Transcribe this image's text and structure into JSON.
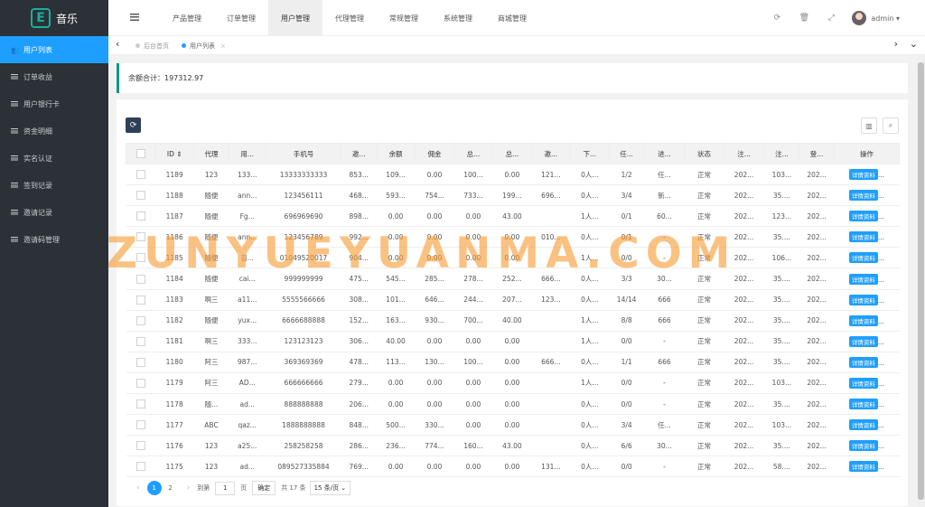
{
  "app": {
    "logo_letter": "E",
    "name": "音乐"
  },
  "sidebar": {
    "items": [
      {
        "label": "用户列表",
        "active": true
      },
      {
        "label": "订单收益"
      },
      {
        "label": "用户银行卡"
      },
      {
        "label": "资金明细"
      },
      {
        "label": "实名认证"
      },
      {
        "label": "签到记录"
      },
      {
        "label": "邀请记录"
      },
      {
        "label": "邀请码管理"
      }
    ]
  },
  "header": {
    "nav": [
      "产品管理",
      "订单管理",
      "用户管理",
      "代理管理",
      "常规管理",
      "系统管理",
      "商城管理"
    ],
    "active_nav": "用户管理",
    "user": "admin"
  },
  "tabs": [
    {
      "label": "后台首页",
      "active": false
    },
    {
      "label": "用户列表",
      "active": true,
      "close": "×"
    }
  ],
  "summary": {
    "label": "余额合计：",
    "value": "197312.97"
  },
  "table": {
    "columns": [
      "ID",
      "代理",
      "用...",
      "手机号",
      "邀...",
      "余额",
      "佣金",
      "总...",
      "总...",
      "邀...",
      "下...",
      "任...",
      "进...",
      "状态",
      "注...",
      "注...",
      "登...",
      "操作"
    ],
    "action_label": "详情资料",
    "rows": [
      [
        "1189",
        "123",
        "133...",
        "13333333333",
        "853...",
        "109...",
        "0.00",
        "100...",
        "0.00",
        "121...",
        "0人...",
        "1/2",
        "任...",
        "正常",
        "202...",
        "103...",
        "202..."
      ],
      [
        "1188",
        "随便",
        "ann...",
        "123456111",
        "468...",
        "593...",
        "754...",
        "733...",
        "199...",
        "696...",
        "0人...",
        "3/4",
        "新...",
        "正常",
        "202...",
        "35....",
        "202..."
      ],
      [
        "1187",
        "随便",
        "Fg...",
        "696969690",
        "898...",
        "0.00",
        "0.00",
        "0.00",
        "43.00",
        "",
        "1人...",
        "0/1",
        "60...",
        "正常",
        "202...",
        "123...",
        "202..."
      ],
      [
        "1186",
        "随便",
        "ann...",
        "123456789",
        "992...",
        "0.00",
        "0.00",
        "0.00",
        "0.00",
        "010...",
        "0人...",
        "0/1",
        "-",
        "正常",
        "202...",
        "35....",
        "202..."
      ],
      [
        "1185",
        "随便",
        "김...",
        "01049520017",
        "904...",
        "0.00",
        "0.00",
        "0.00",
        "0.00",
        "",
        "1人...",
        "0/0",
        "-",
        "正常",
        "202...",
        "106...",
        "202..."
      ],
      [
        "1184",
        "随便",
        "cai...",
        "999999999",
        "475...",
        "545...",
        "285...",
        "278...",
        "252...",
        "666...",
        "0人...",
        "3/3",
        "30...",
        "正常",
        "202...",
        "35....",
        "202..."
      ],
      [
        "1183",
        "啊三",
        "a11...",
        "5555566666",
        "308...",
        "101...",
        "646...",
        "244...",
        "207...",
        "123...",
        "0人...",
        "14/14",
        "666",
        "正常",
        "202...",
        "35....",
        "202..."
      ],
      [
        "1182",
        "随便",
        "yux...",
        "6666688888",
        "152...",
        "163...",
        "930...",
        "700...",
        "40.00",
        "",
        "1人...",
        "8/8",
        "666",
        "正常",
        "202...",
        "35....",
        "202..."
      ],
      [
        "1181",
        "啊三",
        "333...",
        "123123123",
        "306...",
        "40.00",
        "0.00",
        "0.00",
        "0.00",
        "",
        "1人...",
        "0/0",
        "-",
        "正常",
        "202...",
        "35....",
        "202..."
      ],
      [
        "1180",
        "阿三",
        "987...",
        "369369369",
        "478...",
        "113...",
        "130...",
        "100...",
        "0.00",
        "666...",
        "0人...",
        "1/1",
        "666",
        "正常",
        "202...",
        "35....",
        "202..."
      ],
      [
        "1179",
        "阿三",
        "AD...",
        "666666666",
        "279...",
        "0.00",
        "0.00",
        "0.00",
        "0.00",
        "",
        "1人...",
        "0/0",
        "-",
        "正常",
        "202...",
        "103...",
        "202..."
      ],
      [
        "1178",
        "随...",
        "ad...",
        "888888888",
        "206...",
        "0.00",
        "0.00",
        "0.00",
        "0.00",
        "",
        "0人...",
        "0/0",
        "-",
        "正常",
        "202...",
        "35....",
        "202..."
      ],
      [
        "1177",
        "ABC",
        "qaz...",
        "1888888888",
        "848...",
        "500...",
        "330...",
        "0.00",
        "0.00",
        "",
        "0人...",
        "3/4",
        "任...",
        "正常",
        "202...",
        "103...",
        "202..."
      ],
      [
        "1176",
        "123",
        "a25...",
        "258258258",
        "286...",
        "236...",
        "774...",
        "160...",
        "43.00",
        "",
        "0人...",
        "6/6",
        "30...",
        "正常",
        "202...",
        "35....",
        "202..."
      ],
      [
        "1175",
        "123",
        "ad...",
        "089527335884",
        "769...",
        "0.00",
        "0.00",
        "0.00",
        "0.00",
        "131...",
        "0人...",
        "0/0",
        "-",
        "正常",
        "202...",
        "58....",
        "202..."
      ]
    ]
  },
  "pager": {
    "pages": [
      "1",
      "2"
    ],
    "current": "1",
    "goto_label": "到第",
    "goto_value": "1",
    "page_unit": "页",
    "confirm": "确定",
    "total": "共 17 条",
    "per_page": "15 条/页"
  },
  "watermark": "ZUNYUEYUANMA.COM",
  "colors": {
    "sidebar_bg": "#2b3137",
    "accent": "#1e9fff",
    "teal": "#009688",
    "watermark": "#f79c36"
  }
}
